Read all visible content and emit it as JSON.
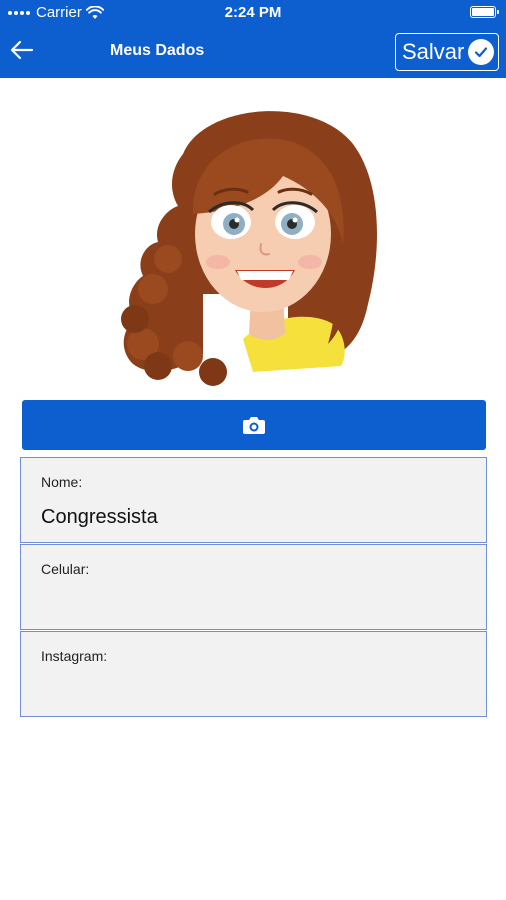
{
  "status_bar": {
    "carrier": "Carrier",
    "time": "2:24 PM"
  },
  "header": {
    "title": "Meus Dados",
    "save_label": "Salvar",
    "background_color": "#0d5ecf"
  },
  "profile": {
    "avatar_description": "cartoon-girl-avatar"
  },
  "photo_button": {
    "icon": "camera-icon"
  },
  "form": {
    "fields": [
      {
        "label": "Nome:",
        "value": "Congressista"
      },
      {
        "label": "Celular:",
        "value": ""
      },
      {
        "label": "Instagram:",
        "value": ""
      }
    ]
  }
}
